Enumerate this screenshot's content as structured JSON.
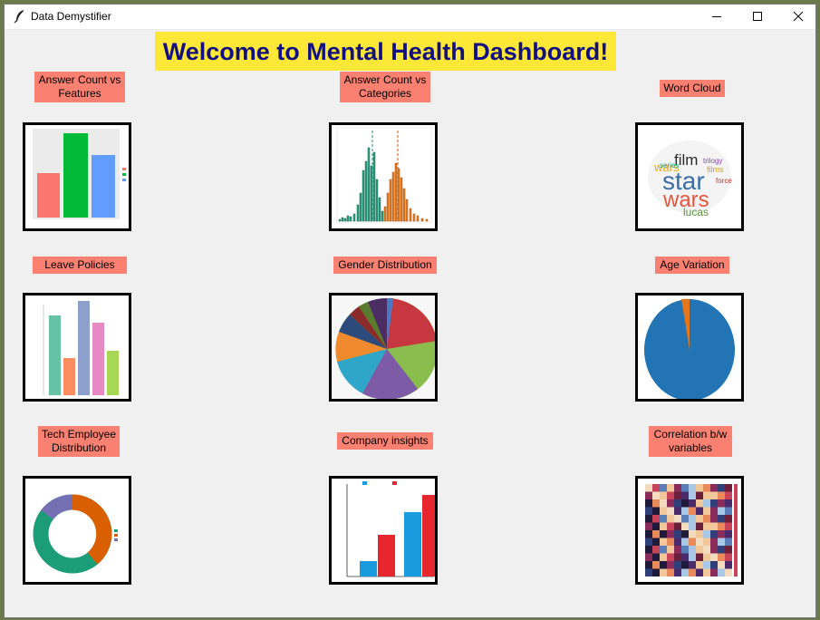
{
  "window": {
    "title": "Data Demystifier"
  },
  "banner": {
    "text": "Welcome to Mental Health Dashboard!"
  },
  "tiles": [
    {
      "label": "Answer Count vs Features",
      "icon": "bar-chart-thumbnail"
    },
    {
      "label": "Answer Count vs Categories",
      "icon": "histogram-thumbnail"
    },
    {
      "label": "Word Cloud",
      "icon": "word-cloud-thumbnail"
    },
    {
      "label": "Leave Policies",
      "icon": "bar-chart-thumbnail"
    },
    {
      "label": "Gender Distribution",
      "icon": "pie-chart-thumbnail"
    },
    {
      "label": "Age Variation",
      "icon": "pie-chart-thumbnail"
    },
    {
      "label": "Tech Employee Distribution",
      "icon": "donut-chart-thumbnail"
    },
    {
      "label": "Company insights",
      "icon": "grouped-bar-thumbnail"
    },
    {
      "label": "Correlation b/w variables",
      "icon": "heatmap-thumbnail"
    }
  ],
  "word_cloud": {
    "words": [
      "star",
      "wars",
      "film",
      "series",
      "lucas",
      "trilogy",
      "force",
      "films"
    ]
  },
  "colors": {
    "banner_bg": "#fde838",
    "banner_text": "#121080",
    "label_bg": "#fa8072"
  }
}
